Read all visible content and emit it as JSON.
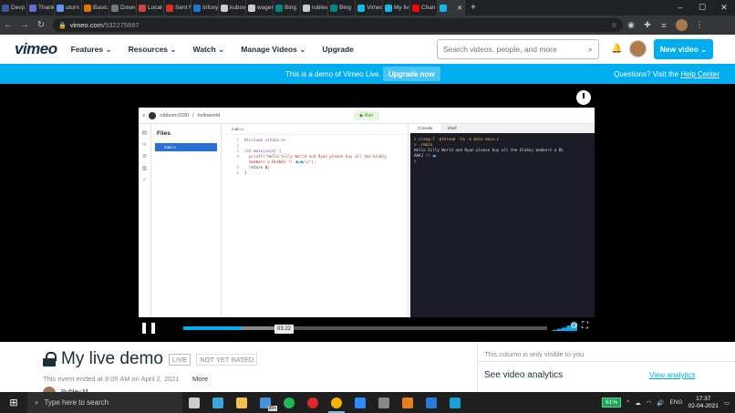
{
  "browser": {
    "tabs": [
      {
        "label": "Devp",
        "color": "#3b5998"
      },
      {
        "label": "Thank",
        "color": "#6b6bd6"
      },
      {
        "label": "uturn",
        "color": "#5e97f6"
      },
      {
        "label": "Basic",
        "color": "#e37400"
      },
      {
        "label": "Down",
        "color": "#777777"
      },
      {
        "label": "Local",
        "color": "#cc4444"
      },
      {
        "label": "Sent M",
        "color": "#d93025"
      },
      {
        "label": "Infosy",
        "color": "#1976d2"
      },
      {
        "label": "kubov",
        "color": "#cccccc"
      },
      {
        "label": "wager",
        "color": "#cccccc"
      },
      {
        "label": "Bing",
        "color": "#00897b"
      },
      {
        "label": "rublev",
        "color": "#cccccc"
      },
      {
        "label": "Bing",
        "color": "#00897b"
      },
      {
        "label": "Vimeo",
        "color": "#1ab7ea"
      },
      {
        "label": "My liv",
        "color": "#1ab7ea"
      },
      {
        "label": "Chan",
        "color": "#ff0000"
      },
      {
        "label": "",
        "color": "#1ab7ea",
        "active": true
      }
    ],
    "new_tab": "+",
    "url_host": "vimeo.com",
    "url_path": "/532275697"
  },
  "header": {
    "logo": "vimeo",
    "nav": [
      "Features",
      "Resources",
      "Watch",
      "Manage Videos",
      "Upgrade"
    ],
    "search_placeholder": "Search videos, people, and more",
    "new_video_label": "New video"
  },
  "banner": {
    "text": "This is a demo of Vimeo Live.",
    "button": "Upgrade now",
    "right_text": "Questions? Visit the ",
    "right_link": "Help Center"
  },
  "screen": {
    "user": "rublevm1930",
    "project": "helloworld",
    "run": "Run",
    "files_title": "Files",
    "file_name": "main.c",
    "editor_tab": "main.c",
    "code": [
      {
        "n": "1",
        "t": "#include <stdio.h>"
      },
      {
        "n": "2",
        "t": ""
      },
      {
        "n": "3",
        "t": "int main(void) {"
      },
      {
        "n": "4",
        "t": "  printf(\"Hello Silly World and Ryan please buy all the blahaj"
      },
      {
        "n": "",
        "t": "  members a BLAHAJ !! 🐟🐟\\n\");"
      },
      {
        "n": "5",
        "t": "  return 0;"
      },
      {
        "n": "6",
        "t": "}"
      }
    ],
    "console_tabs": [
      "Console",
      "Shell"
    ],
    "console_lines": [
      "> clang-7 -pthread -lm -o main main.c",
      "> ./main",
      "Hello Silly World and Ryan please buy all the blahaj members a BL",
      "AHAJ !! 🐟",
      "> "
    ]
  },
  "player": {
    "time_tooltip": "03:22",
    "progress": 0.16,
    "buffered": 0.3
  },
  "video": {
    "title": "My live demo",
    "live_badge": "LIVE",
    "rated_badge": "NOT YET RATED",
    "ended_text": "This event ended at 8:05 AM on April 2, 2021",
    "more": "More",
    "owner_name": "Rublev M"
  },
  "side": {
    "note": "This column is only visible to you",
    "analytics_title": "See video analytics",
    "analytics_link": "View analytics"
  },
  "taskbar": {
    "search_placeholder": "Type here to search",
    "badge": "99+",
    "battery": "61%",
    "lang": "ENG",
    "time": "17:37",
    "date": "02-04-2021",
    "apps": [
      {
        "name": "task-view",
        "color": "#cccccc"
      },
      {
        "name": "l-app",
        "color": "#3aa6dd"
      },
      {
        "name": "file-explorer",
        "color": "#f2c14e"
      },
      {
        "name": "photos",
        "color": "#4a90d9"
      },
      {
        "name": "spotify",
        "color": "#1db954"
      },
      {
        "name": "opera",
        "color": "#e0262d"
      },
      {
        "name": "chrome",
        "color": "#f4b400"
      },
      {
        "name": "zoom",
        "color": "#2d8cff"
      },
      {
        "name": "app-grid",
        "color": "#888888"
      },
      {
        "name": "store",
        "color": "#e67e22"
      },
      {
        "name": "vscode",
        "color": "#2b7bd6"
      },
      {
        "name": "app-blue",
        "color": "#1a9fd8"
      }
    ]
  }
}
